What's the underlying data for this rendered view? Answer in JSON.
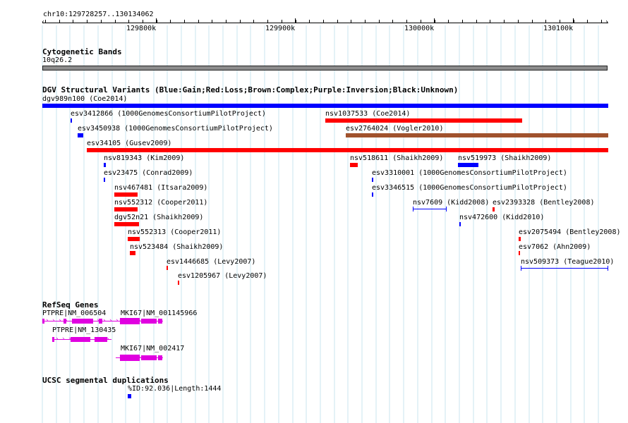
{
  "ruler": {
    "position": "chr10:129728257..130134062",
    "ticks": [
      "129800k",
      "129900k",
      "130000k",
      "130100k"
    ]
  },
  "cytoband": {
    "title": "Cytogenetic Bands",
    "band": "10q26.2"
  },
  "dgv": {
    "title": "DGV Structural Variants (Blue:Gain;Red:Loss;Brown:Complex;Purple:Inversion;Black:Unknown)",
    "colors": {
      "gain": "#0000ff",
      "loss": "#ff0000",
      "complex": "#a0522d"
    },
    "features": [
      {
        "label": "dgv989n100 (Coe2014)",
        "type": "gain"
      },
      {
        "label": "esv3412866 (1000GenomesConsortiumPilotProject)",
        "type": "gain"
      },
      {
        "label": "nsv1037533 (Coe2014)",
        "type": "loss"
      },
      {
        "label": "esv3450938 (1000GenomesConsortiumPilotProject)",
        "type": "gain"
      },
      {
        "label": "esv2764024 (Vogler2010)",
        "type": "complex"
      },
      {
        "label": "esv34105 (Gusev2009)",
        "type": "loss"
      },
      {
        "label": "nsv819343 (Kim2009)",
        "type": "gain"
      },
      {
        "label": "nsv518611 (Shaikh2009)",
        "type": "loss"
      },
      {
        "label": "nsv519973 (Shaikh2009)",
        "type": "gain"
      },
      {
        "label": "esv23475 (Conrad2009)",
        "type": "gain"
      },
      {
        "label": "esv3310001 (1000GenomesConsortiumPilotProject)",
        "type": "gain"
      },
      {
        "label": "nsv467481 (Itsara2009)",
        "type": "loss"
      },
      {
        "label": "esv3346515 (1000GenomesConsortiumPilotProject)",
        "type": "gain"
      },
      {
        "label": "nsv552312 (Cooper2011)",
        "type": "loss"
      },
      {
        "label": "nsv7609 (Kidd2008)",
        "type": "gain"
      },
      {
        "label": "esv2393328 (Bentley2008)",
        "type": "loss"
      },
      {
        "label": "dgv52n21 (Shaikh2009)",
        "type": "loss"
      },
      {
        "label": "nsv472600 (Kidd2010)",
        "type": "gain"
      },
      {
        "label": "nsv552313 (Cooper2011)",
        "type": "loss"
      },
      {
        "label": "esv2075494 (Bentley2008)",
        "type": "loss"
      },
      {
        "label": "nsv523484 (Shaikh2009)",
        "type": "loss"
      },
      {
        "label": "esv7062 (Ahn2009)",
        "type": "loss"
      },
      {
        "label": "esv1446685 (Levy2007)",
        "type": "loss"
      },
      {
        "label": "nsv509373 (Teague2010)",
        "type": "gain"
      },
      {
        "label": "esv1205967 (Levy2007)",
        "type": "loss"
      }
    ]
  },
  "refseq": {
    "title": "RefSeq Genes",
    "color": "#e000e0",
    "genes": [
      {
        "label": "PTPRE|NM_006504"
      },
      {
        "label": "MKI67|NM_001145966"
      },
      {
        "label": "PTPRE|NM_130435"
      },
      {
        "label": "MKI67|NM_002417"
      }
    ]
  },
  "segdup": {
    "title": "UCSC segmental duplications",
    "label": "%ID:92.036|Length:1444",
    "color": "#0000ff"
  }
}
